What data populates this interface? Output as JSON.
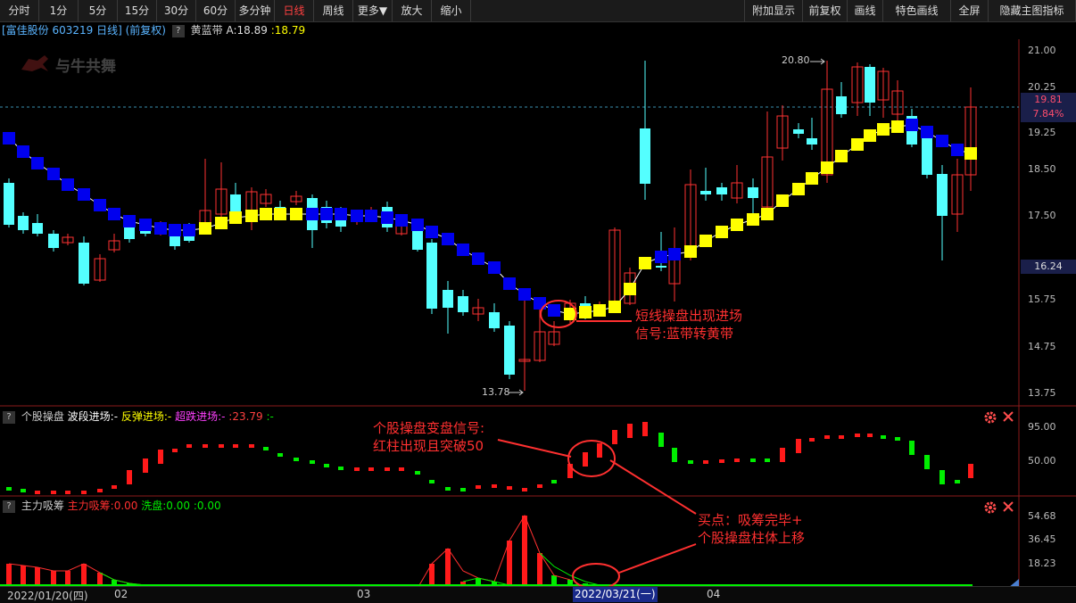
{
  "toolbar": {
    "left": [
      "分时",
      "1分",
      "5分",
      "15分",
      "30分",
      "60分",
      "多分钟",
      "日线",
      "周线",
      "更多▼",
      "放大",
      "缩小"
    ],
    "right": [
      "附加显示",
      "前复权",
      "画线",
      "特色画线",
      "全屏",
      "隐藏主图指标"
    ],
    "active": "日线"
  },
  "header": {
    "stock": "[富佳股份 603219 日线] (前复权)",
    "indicator_name": "黄蓝带",
    "a_value": "A:18.89",
    "b_value": ":18.79"
  },
  "logo_text": "与牛共舞",
  "main_axis": {
    "ticks": [
      "21.00",
      "20.25",
      "19.25",
      "18.50",
      "17.50",
      "15.75",
      "14.75",
      "13.75"
    ],
    "current_price": "19.81",
    "current_pct": "7.84%",
    "ref_price": "16.24"
  },
  "price_marks": {
    "high": "20.80",
    "low": "13.78"
  },
  "annotations": {
    "main_1": "短线操盘出现进场",
    "main_2": "信号:蓝带转黄带",
    "mid_1": "个股操盘变盘信号:",
    "mid_2": "红柱出现且突破50",
    "bot_1": "买点：吸筹完毕+",
    "bot_2": "个股操盘柱体上移"
  },
  "mid_panel": {
    "name": "个股操盘",
    "wave": "波段进场:-",
    "rebound": "反弹进场:-",
    "oversold": "超跌进场:-",
    "value": ":23.79",
    "tail": ":-",
    "ticks": [
      "95.00",
      "50.00"
    ]
  },
  "bot_panel": {
    "name": "主力吸筹",
    "accum": "主力吸筹:0.00",
    "wash": "洗盘:0.00",
    "tail": ":0.00",
    "ticks": [
      "54.68",
      "36.45",
      "18.23"
    ]
  },
  "date_axis": {
    "start": "2022/01/20(四)",
    "m1": "02",
    "m2": "03",
    "cursor": "2022/03/21(一)",
    "m3": "04"
  },
  "colors": {
    "up": "#ff3232",
    "down": "#54ffff",
    "band_blue": "#0000ee",
    "band_yellow": "#ffff00",
    "green": "#00ee00",
    "annot": "#ff3030"
  }
}
